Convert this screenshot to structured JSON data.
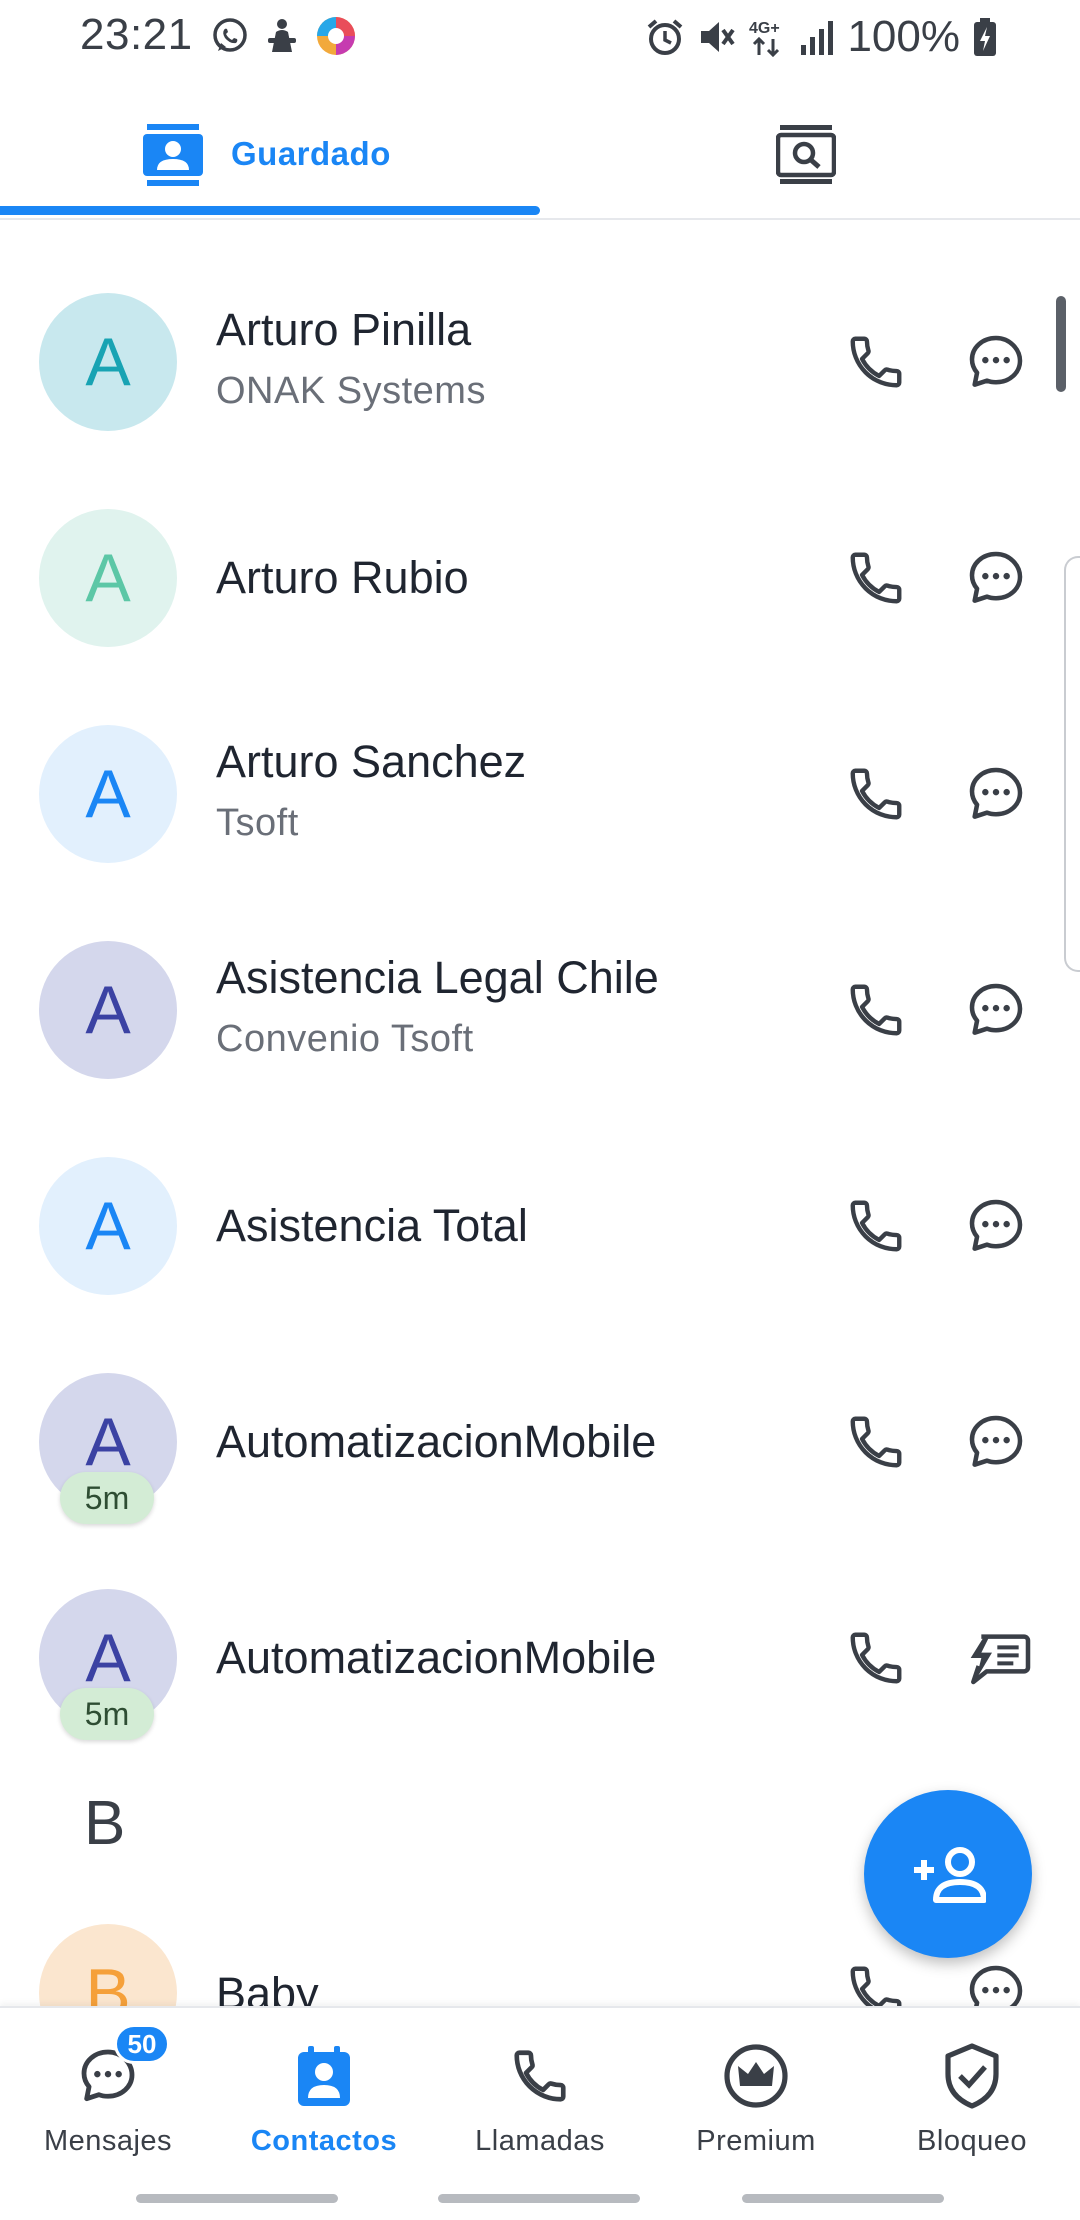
{
  "status_bar": {
    "time": "23:21",
    "battery": "100%",
    "network": "4G+",
    "left_icons": [
      "whatsapp-icon",
      "app-icon",
      "browser-icon"
    ],
    "right_icons": [
      "alarm-icon",
      "mute-icon",
      "network-4g-icon",
      "signal-icon",
      "battery-charging-icon"
    ]
  },
  "tabs": {
    "saved_label": "Guardado",
    "search_icon": "contact-search-icon",
    "active": "saved"
  },
  "contacts": [
    {
      "initial": "A",
      "name": "Arturo Pinilla",
      "subtitle": "ONAK Systems",
      "avatar_bg": "#c8e8ee",
      "avatar_fg": "#18a3b3",
      "badge": "",
      "message_icon": "chat-bubble-icon"
    },
    {
      "initial": "A",
      "name": "Arturo Rubio",
      "subtitle": "",
      "avatar_bg": "#e0f3ee",
      "avatar_fg": "#5cc7a6",
      "badge": "",
      "message_icon": "chat-bubble-icon"
    },
    {
      "initial": "A",
      "name": "Arturo Sanchez",
      "subtitle": "Tsoft",
      "avatar_bg": "#e2f0fd",
      "avatar_fg": "#1a86f5",
      "badge": "",
      "message_icon": "chat-bubble-icon"
    },
    {
      "initial": "A",
      "name": "Asistencia Legal Chile",
      "subtitle": "Convenio Tsoft",
      "avatar_bg": "#d4d7ec",
      "avatar_fg": "#3b42a3",
      "badge": "",
      "message_icon": "chat-bubble-icon"
    },
    {
      "initial": "A",
      "name": "Asistencia Total",
      "subtitle": "",
      "avatar_bg": "#e2f0fd",
      "avatar_fg": "#1a86f5",
      "badge": "",
      "message_icon": "chat-bubble-icon"
    },
    {
      "initial": "A",
      "name": "AutomatizacionMobile",
      "subtitle": "",
      "avatar_bg": "#d4d7ec",
      "avatar_fg": "#3b42a3",
      "badge": "5m",
      "message_icon": "chat-bubble-icon"
    },
    {
      "initial": "A",
      "name": "AutomatizacionMobile",
      "subtitle": "",
      "avatar_bg": "#d4d7ec",
      "avatar_fg": "#3b42a3",
      "badge": "5m",
      "message_icon": "flash-message-icon"
    }
  ],
  "section": {
    "letter": "B"
  },
  "partial_contact": {
    "initial": "B",
    "name": "Baby",
    "avatar_bg": "#fbe6cf",
    "avatar_fg": "#f5a03a"
  },
  "fab": {
    "icon": "add-contact-icon"
  },
  "bottom_nav": [
    {
      "label": "Mensajes",
      "icon": "messages-icon",
      "badge": "50",
      "active": false
    },
    {
      "label": "Contactos",
      "icon": "contacts-icon",
      "badge": "",
      "active": true
    },
    {
      "label": "Llamadas",
      "icon": "phone-icon",
      "badge": "",
      "active": false
    },
    {
      "label": "Premium",
      "icon": "crown-icon",
      "badge": "",
      "active": false
    },
    {
      "label": "Bloqueo",
      "icon": "shield-icon",
      "badge": "",
      "active": false
    }
  ],
  "colors": {
    "accent": "#1a86f5",
    "icon_dark": "#3a3f47"
  }
}
